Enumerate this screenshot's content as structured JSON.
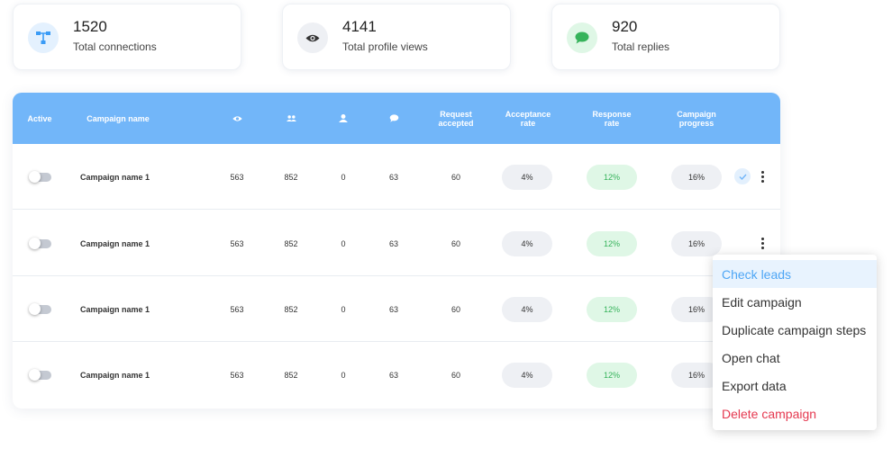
{
  "stats": [
    {
      "value": "1520",
      "label": "Total connections",
      "icon": "connections-icon",
      "color": "#3b9cf6",
      "bg": "#e4f1fe"
    },
    {
      "value": "4141",
      "label": "Total profile views",
      "icon": "eye-icon",
      "color": "#333333",
      "bg": "#eef0f4"
    },
    {
      "value": "920",
      "label": "Total replies",
      "icon": "chat-bubble-icon",
      "color": "#36b35b",
      "bg": "#dff7e6"
    }
  ],
  "table": {
    "header": {
      "active": "Active",
      "campaign_name": "Campaign name",
      "views_icon": "eye-icon",
      "connections_icon": "people-icon",
      "inmail_icon": "profile-icon",
      "replies_icon": "chat-bubble-icon",
      "request_accepted": "Request accepted",
      "acceptance_rate": "Acceptance rate",
      "response_rate": "Response rate",
      "campaign_progress": "Campaign progress"
    },
    "rows": [
      {
        "name": "Campaign name 1",
        "views": "563",
        "connections": "852",
        "inmails": "0",
        "replies": "63",
        "accepted": "60",
        "acceptance": "4%",
        "response": "12%",
        "progress": "16%"
      },
      {
        "name": "Campaign name 1",
        "views": "563",
        "connections": "852",
        "inmails": "0",
        "replies": "63",
        "accepted": "60",
        "acceptance": "4%",
        "response": "12%",
        "progress": "16%"
      },
      {
        "name": "Campaign name 1",
        "views": "563",
        "connections": "852",
        "inmails": "0",
        "replies": "63",
        "accepted": "60",
        "acceptance": "4%",
        "response": "12%",
        "progress": "16%"
      },
      {
        "name": "Campaign name 1",
        "views": "563",
        "connections": "852",
        "inmails": "0",
        "replies": "63",
        "accepted": "60",
        "acceptance": "4%",
        "response": "12%",
        "progress": "16%"
      }
    ]
  },
  "menu": {
    "items": [
      {
        "label": "Check leads",
        "state": "hover"
      },
      {
        "label": "Edit campaign",
        "state": "normal"
      },
      {
        "label": "Duplicate campaign steps",
        "state": "normal"
      },
      {
        "label": "Open chat",
        "state": "normal"
      },
      {
        "label": "Export data",
        "state": "normal"
      },
      {
        "label": "Delete campaign",
        "state": "danger"
      }
    ]
  },
  "colors": {
    "header": "#72b6f9",
    "accent": "#4ea6f5",
    "danger": "#e53950",
    "success": "#36b35b"
  }
}
